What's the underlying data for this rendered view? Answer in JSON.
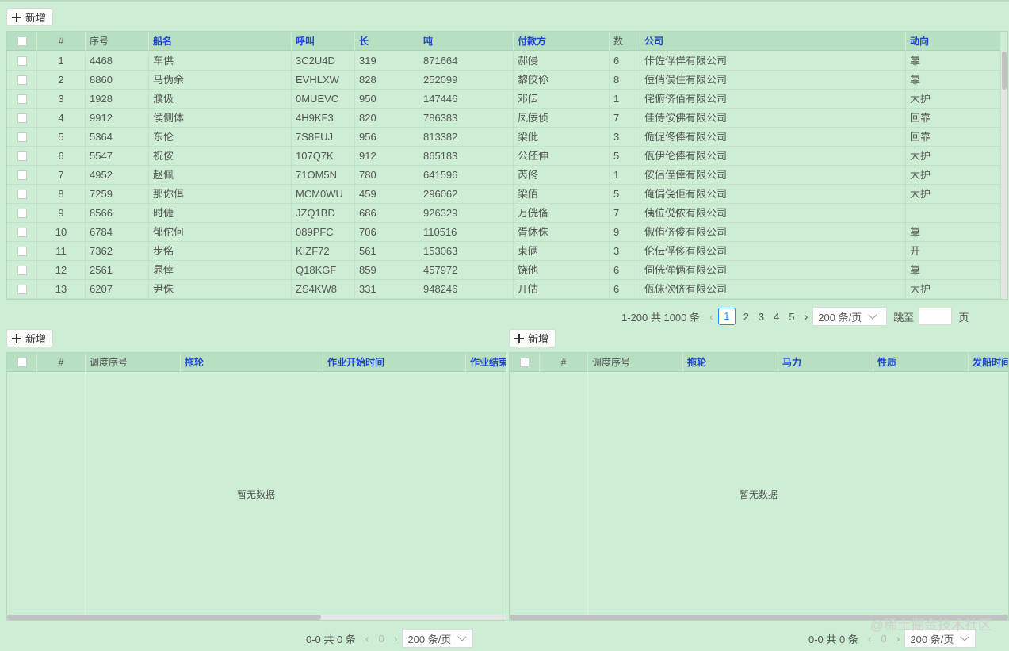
{
  "toolbar_top": {
    "add_label": "新增"
  },
  "main_table": {
    "headers": [
      "#",
      "序号",
      "船名",
      "呼叫",
      "长",
      "吨",
      "付款方",
      "数",
      "公司",
      "动向"
    ],
    "rows": [
      [
        "1",
        "4468",
        "车供",
        "3C2U4D",
        "319",
        "871664",
        "郝侵",
        "6",
        "佧佐俘佯有限公司",
        "靠"
      ],
      [
        "2",
        "8860",
        "马伪余",
        "EVHLXW",
        "828",
        "252099",
        "黎佼伱",
        "8",
        "侸俏俣住有限公司",
        "靠"
      ],
      [
        "3",
        "1928",
        "濮伋",
        "0MUEVC",
        "950",
        "147446",
        "邓伝",
        "1",
        "侘俯侪佰有限公司",
        "大护"
      ],
      [
        "4",
        "9912",
        "侯侧体",
        "4H9KF3",
        "820",
        "786383",
        "凤佞侦",
        "7",
        "佳侍侒佛有限公司",
        "回靠"
      ],
      [
        "5",
        "5364",
        "东伦",
        "7S8FUJ",
        "956",
        "813382",
        "梁仳",
        "3",
        "佹促佟俸有限公司",
        "回靠"
      ],
      [
        "6",
        "5547",
        "祝侒",
        "107Q7K",
        "912",
        "865183",
        "公伾伸",
        "5",
        "佤伊伦俸有限公司",
        "大护"
      ],
      [
        "7",
        "4952",
        "赵佩",
        "71OM5N",
        "780",
        "641596",
        "芮佟",
        "1",
        "侒侣侄倖有限公司",
        "大护"
      ],
      [
        "8",
        "7259",
        "那你佴",
        "MCM0WU",
        "459",
        "296062",
        "梁佰",
        "5",
        "俺侷侥佢有限公司",
        "大护"
      ],
      [
        "9",
        "8566",
        "时倢",
        "JZQ1BD",
        "686",
        "926329",
        "万侊俻",
        "7",
        "侇位侻侬有限公司",
        ""
      ],
      [
        "10",
        "6784",
        "郁佗何",
        "089PFC",
        "706",
        "110516",
        "胥休侏",
        "9",
        "俶侑侪俊有限公司",
        "靠"
      ],
      [
        "11",
        "7362",
        "步佲",
        "KIZF72",
        "561",
        "153063",
        "束俩",
        "3",
        "伦伝俘侈有限公司",
        "开"
      ],
      [
        "12",
        "2561",
        "晁倖",
        "Q18KGF",
        "859",
        "457972",
        "饶他",
        "6",
        "伺侊侔俩有限公司",
        "靠"
      ],
      [
        "13",
        "6207",
        "尹侏",
        "ZS4KW8",
        "331",
        "948246",
        "丌估",
        "6",
        "佤俫佽侪有限公司",
        "大护"
      ]
    ],
    "pagination": {
      "summary": "1-200 共 1000 条",
      "pages": [
        "1",
        "2",
        "3",
        "4",
        "5"
      ],
      "current_page": "1",
      "page_size": "200 条/页",
      "jump_label": "跳至",
      "page_suffix": "页"
    }
  },
  "left_table": {
    "add_label": "新增",
    "headers": [
      "#",
      "调度序号",
      "拖轮",
      "作业开始时间",
      "作业结束"
    ],
    "empty_text": "暂无数据",
    "pagination": {
      "summary": "0-0 共 0 条",
      "page": "0",
      "page_size": "200 条/页"
    }
  },
  "right_table": {
    "add_label": "新增",
    "headers": [
      "#",
      "调度序号",
      "拖轮",
      "马力",
      "性质",
      "发船时间"
    ],
    "empty_text": "暂无数据",
    "pagination": {
      "summary": "0-0 共 0 条",
      "page": "0",
      "page_size": "200 条/页"
    }
  },
  "watermark": "@稀土掘金技术社区",
  "colors": {
    "background": "#cdeed4",
    "header_bg": "#b7dfc2",
    "header_blue": "#1e45d0",
    "pager_active": "#1e90ff"
  }
}
